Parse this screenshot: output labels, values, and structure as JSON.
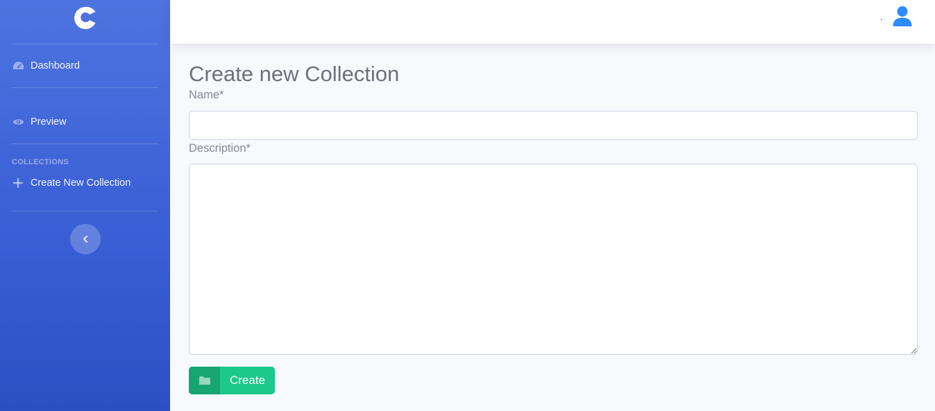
{
  "sidebar": {
    "brand_icon": "c-logo-icon",
    "items": [
      {
        "label": "Dashboard",
        "icon": "tachometer-icon"
      },
      {
        "label": "Preview",
        "icon": "eye-icon"
      }
    ],
    "heading": "COLLECTIONS",
    "create_item": {
      "label": "Create New Collection",
      "icon": "plus-icon"
    },
    "toggle_icon": "chevron-left-icon"
  },
  "topbar": {
    "user_icon": "user-icon",
    "user_color": "#2e8bff"
  },
  "main": {
    "title": "Create new Collection",
    "name_label": "Name*",
    "name_value": "",
    "description_label": "Description*",
    "description_value": "",
    "create_button": {
      "label": "Create",
      "icon": "folder-icon"
    }
  },
  "colors": {
    "sidebar_primary": "#4e73df",
    "success": "#1cc88a",
    "success_dark": "#17a673"
  }
}
